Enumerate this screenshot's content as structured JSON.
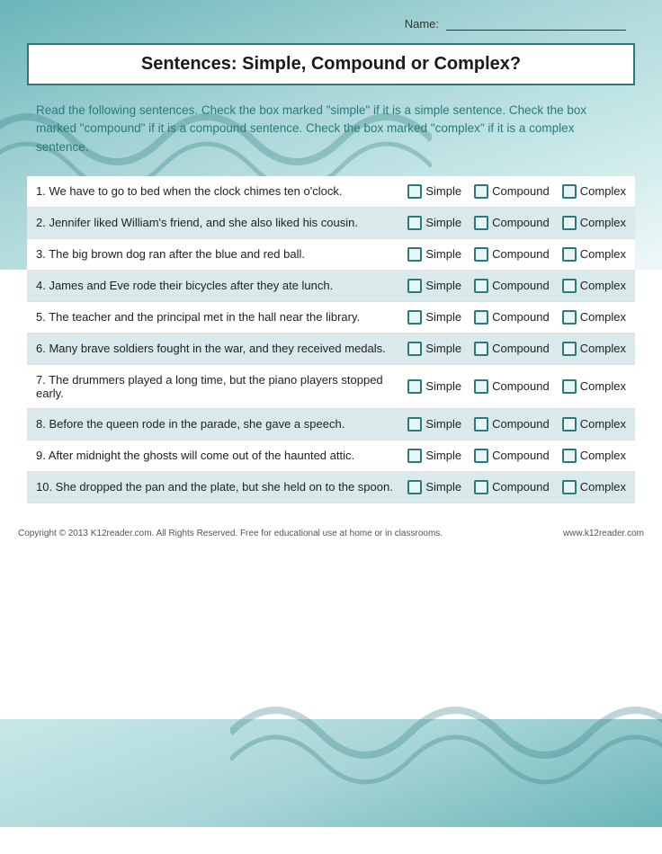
{
  "header": {
    "name_label": "Name:",
    "name_line": ""
  },
  "title": "Sentences: Simple, Compound or Complex?",
  "instructions": "Read the following sentences. Check the box marked \"simple\" if it is a simple sentence. Check the box marked \"compound\" if it is a compound sentence. Check the box marked \"complex\" if it is a complex sentence.",
  "options": [
    "Simple",
    "Compound",
    "Complex"
  ],
  "sentences": [
    {
      "num": "1.",
      "text": "We have to go to bed when the clock chimes ten o'clock."
    },
    {
      "num": "2.",
      "text": "Jennifer liked William's friend, and she also liked his cousin."
    },
    {
      "num": "3.",
      "text": "The big brown dog ran after the blue and red ball."
    },
    {
      "num": "4.",
      "text": "James and Eve rode their bicycles after they ate lunch."
    },
    {
      "num": "5.",
      "text": "The teacher and the principal met in the hall near the library."
    },
    {
      "num": "6.",
      "text": "Many brave soldiers fought in the war, and they received medals."
    },
    {
      "num": "7.",
      "text": "The drummers played a long time, but the piano players stopped early."
    },
    {
      "num": "8.",
      "text": "Before the queen rode in the parade, she gave a speech."
    },
    {
      "num": "9.",
      "text": "After midnight the ghosts will come out of the haunted attic."
    },
    {
      "num": "10.",
      "text": "She dropped the pan and the plate, but she held on to the spoon."
    }
  ],
  "footer": {
    "copyright": "Copyright © 2013 K12reader.com. All Rights Reserved. Free for educational use at home or in classrooms.",
    "url": "www.k12reader.com"
  }
}
